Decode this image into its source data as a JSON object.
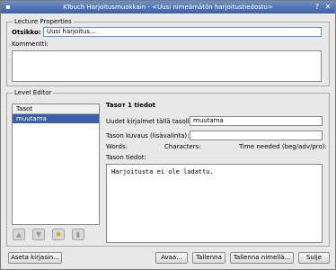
{
  "window": {
    "title": "KTouch Harjoitusmuokkain - <Uusi nimeämätön harjoitustiedosto>"
  },
  "lecture": {
    "group_title": "Lecture Properties",
    "title_label": "Otsikko:",
    "title_value": "Uusi harjoitus...",
    "comment_label": "Kommentti:",
    "comment_value": ""
  },
  "level_editor": {
    "group_title": "Level Editor",
    "list_header": "Tasot",
    "levels": [
      {
        "label": "muutama"
      }
    ],
    "details_title": "Tasoт 1 tiedot",
    "new_chars_label": "Uudet kirjaimet tällä tasolla",
    "new_chars_value": "muutama",
    "description_label": "Tason kuvaus (lisävalinta):",
    "description_value": "",
    "words_label": "Words:",
    "characters_label": "Characters:",
    "time_label": "Time needed (beg/adv/pro):",
    "level_data_label": "Tason tiedot:",
    "level_data_text": "Harjoitusta ei ole ladattu."
  },
  "buttons": {
    "set_font": "Aseta kirjasin...",
    "open": "Avaa...",
    "save": "Tallenna",
    "save_as": "Tallenna nimellä...",
    "close": "Sulje"
  }
}
